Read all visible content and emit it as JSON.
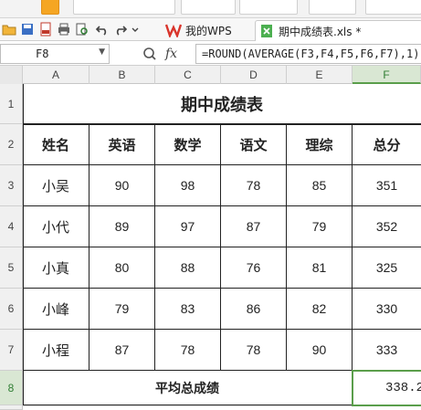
{
  "tabs": {
    "my_wps": "我的WPS",
    "file": "期中成绩表.xls *"
  },
  "formula_bar": {
    "cell_ref": "F8",
    "fx": "fx",
    "formula": "=ROUND(AVERAGE(F3,F4,F5,F6,F7),1)"
  },
  "columns": [
    "A",
    "B",
    "C",
    "D",
    "E",
    "F"
  ],
  "rows": [
    "1",
    "2",
    "3",
    "4",
    "5",
    "6",
    "7",
    "8"
  ],
  "sheet": {
    "title": "期中成绩表",
    "headers": [
      "姓名",
      "英语",
      "数学",
      "语文",
      "理综",
      "总分"
    ],
    "data": [
      [
        "小吴",
        "90",
        "98",
        "78",
        "85",
        "351"
      ],
      [
        "小代",
        "89",
        "97",
        "87",
        "79",
        "352"
      ],
      [
        "小真",
        "80",
        "88",
        "76",
        "81",
        "325"
      ],
      [
        "小峰",
        "79",
        "83",
        "86",
        "82",
        "330"
      ],
      [
        "小程",
        "87",
        "78",
        "78",
        "90",
        "333"
      ]
    ],
    "avg_label": "平均总成绩",
    "avg_value": "338.2"
  },
  "colors": {
    "accent_green": "#5a9e4b",
    "wps_red": "#d9342b"
  }
}
